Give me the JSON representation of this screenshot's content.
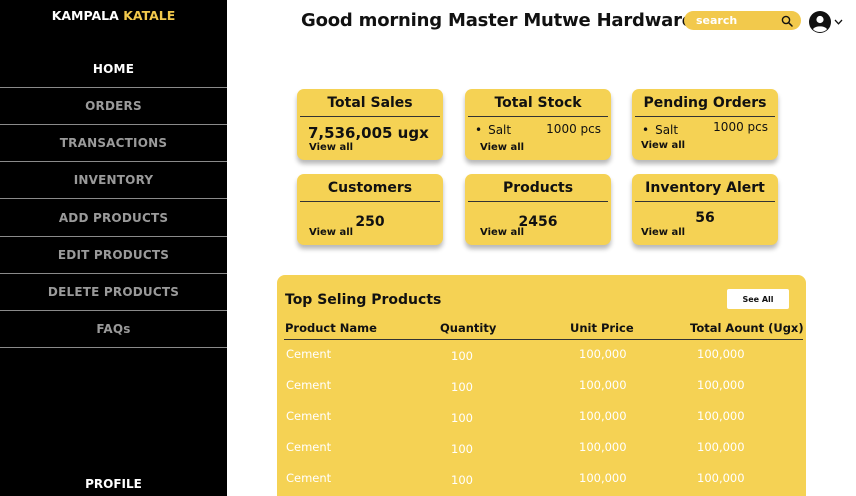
{
  "brand": {
    "part1": "KAMPALA",
    "part2": "KATALE"
  },
  "sidebar": {
    "items": [
      {
        "label": "HOME"
      },
      {
        "label": "ORDERS"
      },
      {
        "label": "TRANSACTIONS"
      },
      {
        "label": "INVENTORY"
      },
      {
        "label": "ADD PRODUCTS"
      },
      {
        "label": "EDIT PRODUCTS"
      },
      {
        "label": "DELETE PRODUCTS"
      },
      {
        "label": "FAQs"
      }
    ],
    "profile": "PROFILE"
  },
  "header": {
    "greeting": "Good morning Master Mutwe Hardware,",
    "search_placeholder": "search"
  },
  "cards": {
    "total_sales": {
      "title": "Total Sales",
      "value": "7,536,005 ugx",
      "link": "View all"
    },
    "total_stock": {
      "title": "Total Stock",
      "item": "Salt",
      "qty": "1000 pcs",
      "link": "View all"
    },
    "pending_orders": {
      "title": "Pending Orders",
      "item": "Salt",
      "qty": "1000 pcs",
      "link": "View all"
    },
    "customers": {
      "title": "Customers",
      "value": "250",
      "link": "View all"
    },
    "products": {
      "title": "Products",
      "value": "2456",
      "link": "View all"
    },
    "inventory_alert": {
      "title": "Inventory Alert",
      "value": "56",
      "link": "View all"
    }
  },
  "top_selling": {
    "title": "Top Seling Products",
    "see_all": "See All",
    "columns": [
      "Product Name",
      "Quantity",
      "Unit Price",
      "Total Aount (Ugx)"
    ],
    "rows": [
      {
        "name": "Cement",
        "quantity": "100",
        "unit_price": "100,000",
        "total": "100,000"
      },
      {
        "name": "Cement",
        "quantity": "100",
        "unit_price": "100,000",
        "total": "100,000"
      },
      {
        "name": "Cement",
        "quantity": "100",
        "unit_price": "100,000",
        "total": "100,000"
      },
      {
        "name": "Cement",
        "quantity": "100",
        "unit_price": "100,000",
        "total": "100,000"
      },
      {
        "name": "Cement",
        "quantity": "100",
        "unit_price": "100,000",
        "total": "100,000"
      }
    ]
  },
  "colors": {
    "accent": "#F5D254",
    "sidebar_bg": "#000000",
    "nav_inactive": "#9A9A9A",
    "table_text": "#FFFFFF"
  }
}
